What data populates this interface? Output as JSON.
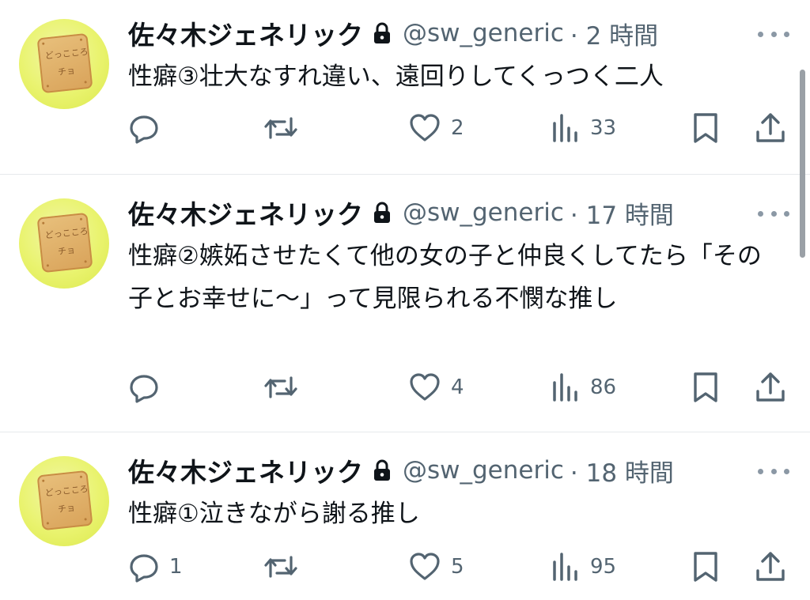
{
  "tweets": [
    {
      "name": "佐々木ジェネリック",
      "handle": "@sw_generic",
      "time": "· 2 時間",
      "text": "性癖③壮大なすれ違い、遠回りしてくっつく二人",
      "replies": "",
      "likes": "2",
      "views": "33"
    },
    {
      "name": "佐々木ジェネリック",
      "handle": "@sw_generic",
      "time": "· 17 時間",
      "text": "性癖②嫉妬させたくて他の女の子と仲良くしてたら「その子とお幸せに〜」って見限られる不憫な推し",
      "replies": "",
      "likes": "4",
      "views": "86"
    },
    {
      "name": "佐々木ジェネリック",
      "handle": "@sw_generic",
      "time": "· 18 時間",
      "text": "性癖①泣きながら謝る推し",
      "replies": "1",
      "likes": "5",
      "views": "95"
    }
  ],
  "avatar_text": {
    "line1": "どっこころ",
    "line2": "チョ"
  },
  "icons": {
    "reply": "reply-icon",
    "retweet": "retweet-icon",
    "like": "heart-icon",
    "views": "views-chart-icon",
    "bookmark": "bookmark-icon",
    "share": "share-icon",
    "lock": "lock-icon",
    "more": "more-dots-icon"
  },
  "colors": {
    "text": "#0f1419",
    "secondary": "#536471",
    "divider": "#e6e9ec"
  }
}
